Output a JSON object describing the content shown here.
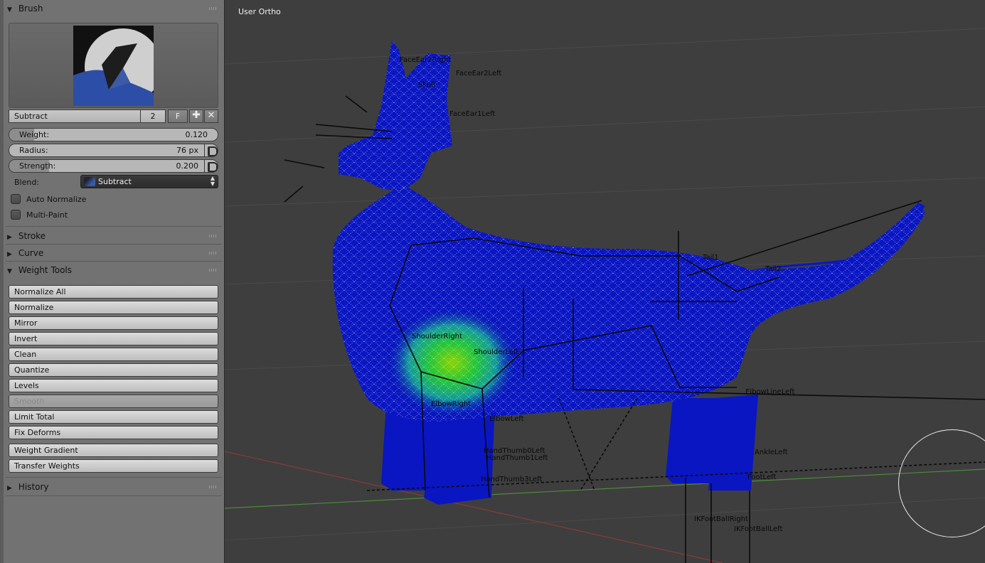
{
  "panel": {
    "brush": {
      "header": "Brush",
      "name": "Subtract",
      "users": "2",
      "fake_user": "F",
      "weight": {
        "label": "Weight:",
        "value": "0.120",
        "fraction": 0.12
      },
      "radius": {
        "label": "Radius:",
        "value": "76 px"
      },
      "strength": {
        "label": "Strength:",
        "value": "0.200",
        "fraction": 0.2
      },
      "blend": {
        "label": "Blend:",
        "value": "Subtract"
      },
      "auto_normalize": "Auto Normalize",
      "multi_paint": "Multi-Paint"
    },
    "stroke_header": "Stroke",
    "curve_header": "Curve",
    "weight_tools": {
      "header": "Weight Tools",
      "buttons": [
        "Normalize All",
        "Normalize",
        "Mirror",
        "Invert",
        "Clean",
        "Quantize",
        "Levels",
        "Smooth",
        "Limit Total",
        "Fix Deforms",
        "Weight Gradient",
        "Transfer Weights"
      ]
    },
    "history_header": "History"
  },
  "viewport": {
    "view_label": "User Ortho",
    "bones": {
      "face_ear2_right": "FaceEar2Right",
      "face_ear2_left": "FaceEar2Left",
      "skull": "Skull",
      "face_ear1_left": "FaceEar1Left",
      "tail1": "Tail1",
      "tail2": "Tail2",
      "shoulder_right": "ShoulderRight",
      "shoulder_left": "ShoulderLeft",
      "elbow_right": "ElbowRight",
      "elbow_left": "ElbowLeft",
      "hand_thumb0_left": "HandThumb0Left",
      "hand_thumb1_left": "HandThumb1Left",
      "hand_thumb3_left": "HandThumb3Left",
      "elbow_line_left": "ElbowLineLeft",
      "ankle_left": "AnkleLeft",
      "foot_left": "FootLeft",
      "ik_foot_ball_right": "IKFootBallRight",
      "ik_foot_ball_left": "IKFootBallLeft"
    }
  }
}
